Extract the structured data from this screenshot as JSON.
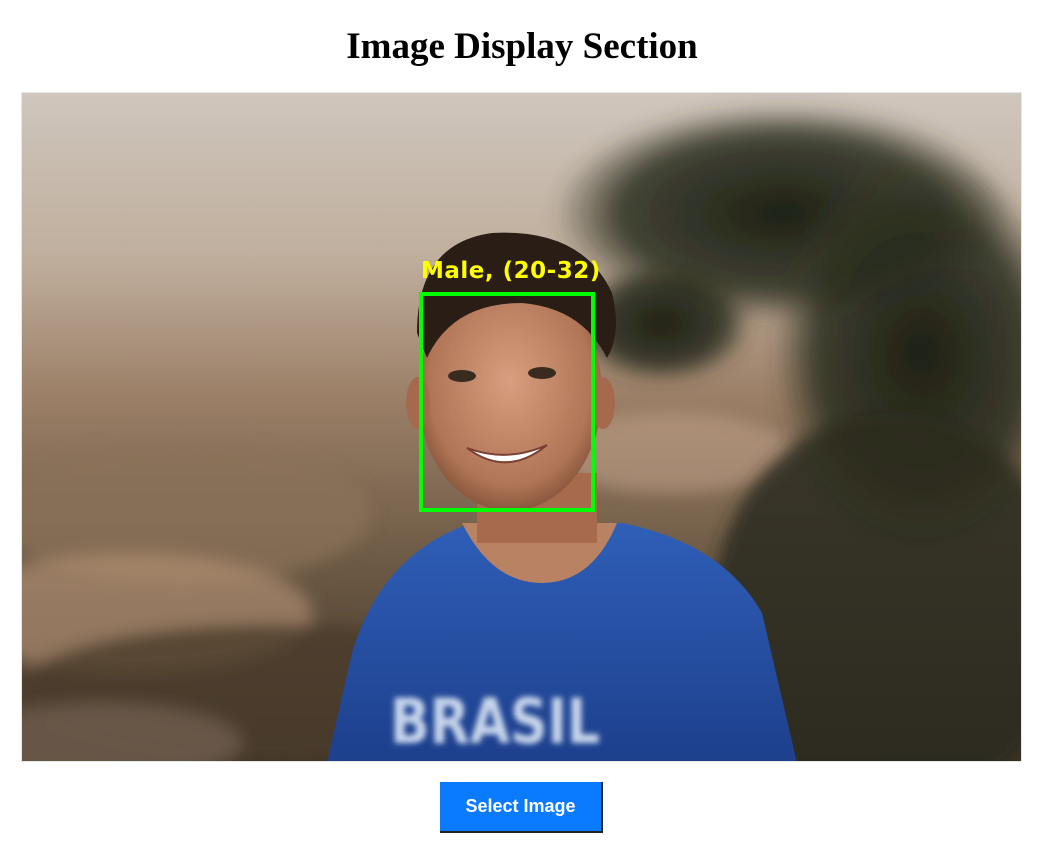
{
  "page": {
    "title": "Image Display Section"
  },
  "image": {
    "detection": {
      "label": "Male, (20-32)",
      "box_color": "#00ff00",
      "label_color": "#ffff00"
    },
    "shirt_text": "BRASIL"
  },
  "controls": {
    "select_label": "Select Image",
    "button_color": "#0a7bff"
  }
}
